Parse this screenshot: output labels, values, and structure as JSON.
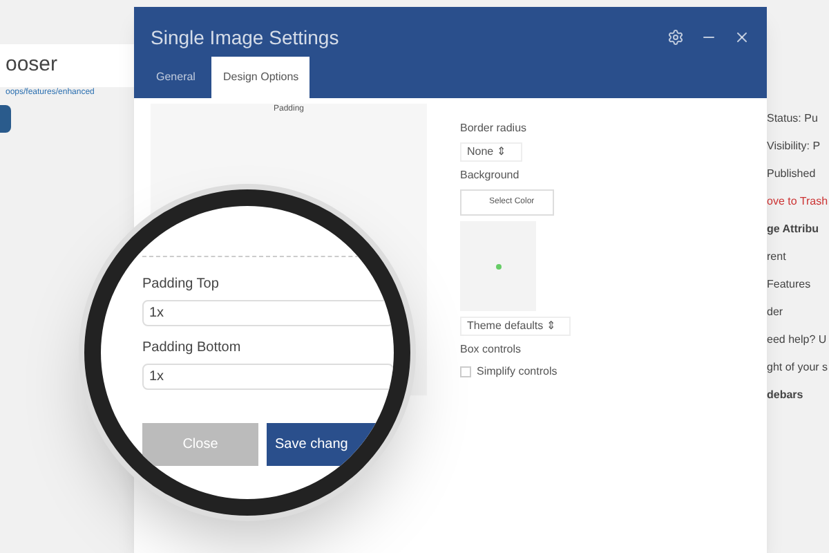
{
  "left_panel": {
    "heading": "ooser",
    "link": "oops/features/enhanced"
  },
  "modal": {
    "title": "Single Image Settings",
    "tabs": [
      {
        "label": "General",
        "selected": false
      },
      {
        "label": "Design Options",
        "selected": true
      }
    ],
    "box_label": "Padding",
    "border_radius": {
      "label": "Border radius",
      "value": "None ⇕"
    },
    "background": {
      "label": "Background",
      "button": "Select Color"
    },
    "style_select": "Theme defaults ⇕",
    "box_controls": {
      "label": "Box controls",
      "option": "Simplify controls",
      "checked": false
    }
  },
  "magnifier": {
    "padding_top": {
      "label": "Padding Top",
      "value": "1x"
    },
    "padding_bottom": {
      "label": "Padding Bottom",
      "value": "1x"
    },
    "buttons": [
      "Close",
      "Save chang"
    ]
  },
  "right_panel": {
    "items": [
      "Status: Pu",
      "Visibility: P",
      "Published"
    ],
    "trash": "ove to Trash",
    "attributes": "ge Attribu",
    "parent": "rent",
    "parent_value": "Features",
    "order": "der",
    "help": "eed help? U",
    "help_2": "ght of your s",
    "sidebars": "debars"
  }
}
